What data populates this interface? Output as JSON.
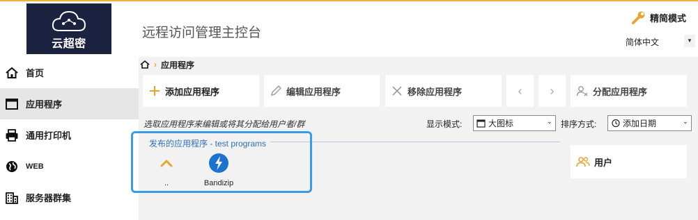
{
  "header": {
    "logo_text": "云超密",
    "app_title": "远程访问管理主控台",
    "mode_label": "精简模式",
    "language": "简体中文"
  },
  "sidebar": {
    "items": [
      {
        "label": "首页",
        "icon": "home-icon"
      },
      {
        "label": "应用程序",
        "icon": "window-icon",
        "active": true
      },
      {
        "label": "通用打印机",
        "icon": "printer-icon"
      },
      {
        "label": "WEB",
        "icon": "globe-icon"
      },
      {
        "label": "服务器群集",
        "icon": "building-icon"
      }
    ]
  },
  "breadcrumb": {
    "current": "应用程序"
  },
  "toolbar": {
    "add": "添加应用程序",
    "edit": "编辑应用程序",
    "remove": "移除应用程序",
    "assign": "分配应用程序"
  },
  "hint": "选取应用程序来编辑或将其分配给用户者/群",
  "display_mode": {
    "label": "显示模式:",
    "value": "大图标"
  },
  "sort": {
    "label": "排序方式:",
    "value": "添加日期"
  },
  "group": {
    "title": "发布的应用程序 - test programs",
    "items": [
      {
        "label": "..",
        "icon": "chevron-up-icon"
      },
      {
        "label": "Bandizip",
        "icon": "bandizip-icon"
      }
    ]
  },
  "users_panel": {
    "label": "用户"
  },
  "colors": {
    "accent": "#e8a330",
    "logo_bg": "#1c2340",
    "highlight": "#3a9be8",
    "group_title": "#2f6fbd"
  }
}
